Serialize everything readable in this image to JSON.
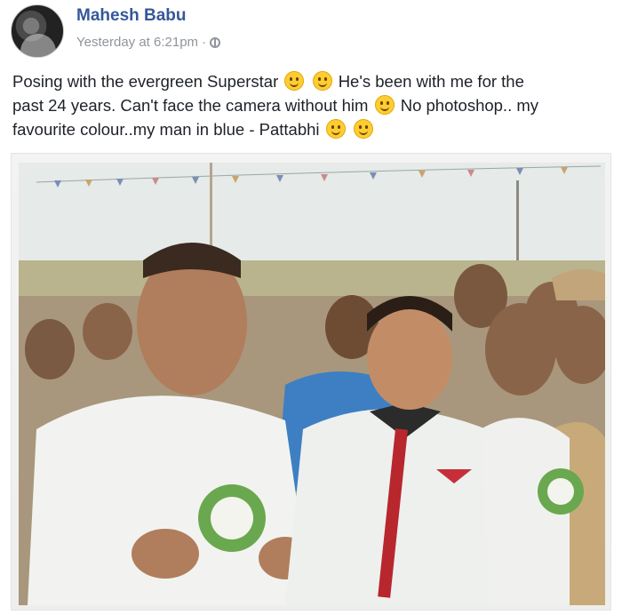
{
  "post": {
    "author": "Mahesh Babu",
    "timestamp": "Yesterday at 6:21pm",
    "separator": "·",
    "privacy_icon": "globe-icon",
    "text": {
      "line1_a": "Posing with the evergreen Superstar",
      "line1_b": "He's been with me for the",
      "line2_a": "past 24 years. Can't face the camera without him",
      "line2_b": "No photoshop.. my",
      "line3_a": "favourite colour..my man in blue - Pattabhi"
    },
    "emoji_icon": "smile-emoji-icon",
    "colors": {
      "author_link": "#365899",
      "meta_text": "#90949c",
      "body_text": "#1d2129"
    }
  }
}
